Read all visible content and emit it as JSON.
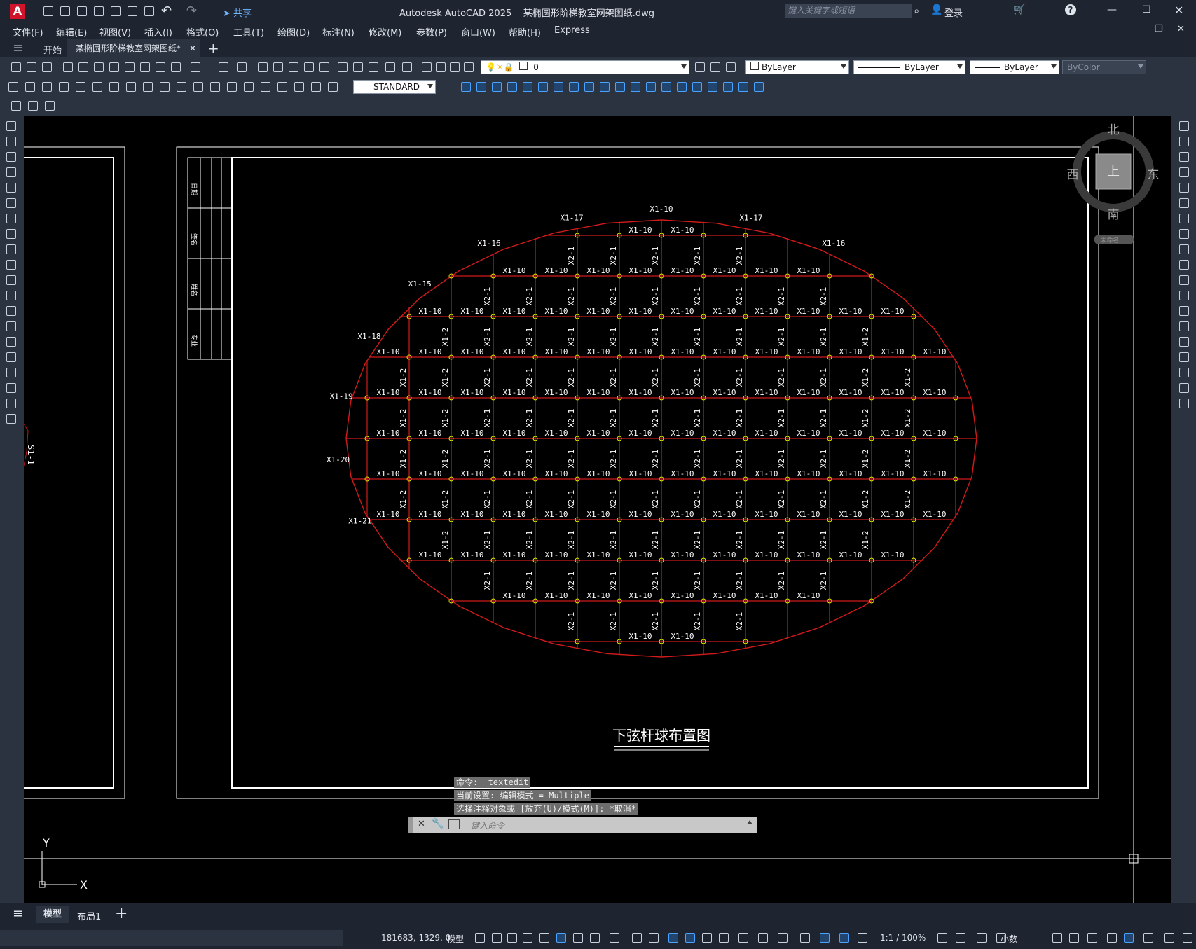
{
  "titlebar": {
    "app_icon": "A",
    "title": "Autodesk AutoCAD 2025    某椭圆形阶梯教室网架图纸.dwg",
    "share": "共享",
    "search_placeholder": "键入关键字或短语",
    "login": "登录"
  },
  "menu": [
    "文件(F)",
    "编辑(E)",
    "视图(V)",
    "插入(I)",
    "格式(O)",
    "工具(T)",
    "绘图(D)",
    "标注(N)",
    "修改(M)",
    "参数(P)",
    "窗口(W)",
    "帮助(H)",
    "Express"
  ],
  "tabs": {
    "start": "开始",
    "document": "某椭圆形阶梯教室网架图纸*"
  },
  "props": {
    "layer": "0",
    "color": "ByLayer",
    "linetype": "ByLayer",
    "lineweight": "ByLayer",
    "plotstyle": "ByColor",
    "textstyle": "STANDARD"
  },
  "viewcube": {
    "north": "北",
    "south": "南",
    "east": "东",
    "west": "西",
    "top": "上",
    "wcs": "未命名"
  },
  "drawing": {
    "title": "下弦杆球布置图",
    "left_frag": "S1-1",
    "titleblock": [
      "日期",
      "签名",
      "姓名",
      "专业"
    ],
    "top_labels": [
      "X1-16",
      "X1-17",
      "X1-10",
      "X1-17",
      "X1-16",
      "X1-15",
      "X1-18",
      "X1-19",
      "X1-20",
      "X1-21"
    ],
    "h_label": "X1-10",
    "v_label": "X2-1",
    "v_label2": "X1-2"
  },
  "axes": {
    "x": "X",
    "y": "Y"
  },
  "command": {
    "history": [
      "命令: _textedit",
      "当前设置: 编辑模式 = Multiple",
      "选择注释对象或 [放弃(U)/模式(M)]: *取消*"
    ],
    "placeholder": "键入命令"
  },
  "layout_tabs": [
    "模型",
    "布局1"
  ],
  "status": {
    "coords": "181683, 1329, 0",
    "model": "模型",
    "scale": "1:1 / 100%",
    "units": "小数"
  }
}
